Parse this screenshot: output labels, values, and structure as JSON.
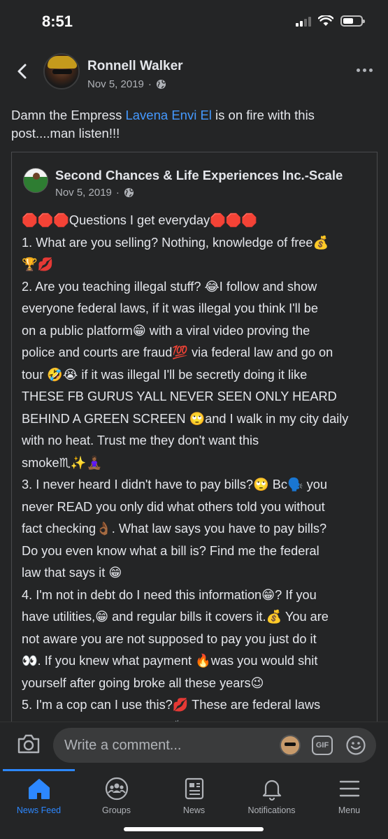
{
  "status_bar": {
    "time": "8:51"
  },
  "header": {
    "author": "Ronnell Walker",
    "date": "Nov 5, 2019",
    "separator": "·"
  },
  "post": {
    "text_before": "Damn the Empress ",
    "mention": "Lavena Envi El",
    "text_after": " is on fire with this post....man listen!!!"
  },
  "shared_post": {
    "author": "Second Chances & Life Experiences Inc.-Scale",
    "date": "Nov 5, 2019",
    "separator": "·",
    "lines": [
      "🛑🛑🛑Questions I get everyday🛑🛑🛑",
      "1. What are you selling? Nothing, knowledge of free💰",
      "🏆💋",
      "2. Are you teaching illegal stuff? 😂I follow and show",
      "everyone federal laws, if it was illegal you think I'll be",
      "on a public platform😁 with a viral video proving the",
      "police and courts are fraud💯 via federal law and go on",
      "tour 🤣😭 if it was illegal I'll be secretly doing it like",
      "THESE FB GURUS YALL NEVER SEEN ONLY HEARD",
      "BEHIND A GREEN SCREEN 🙄and I walk in my city daily",
      "with no heat. Trust me they don't want this",
      "smoke♏✨🧘🏾‍♀️",
      "3. I never heard I didn't have to pay bills?🙄 Bc🗣️ you",
      "never READ you only did what others told you without",
      "fact checking👌🏾. What law says you have to pay bills?",
      "Do you even know what a bill is? Find me the federal",
      "law that says it 😁",
      "4. I'm not in debt do I need this information😁? If you",
      "have utilities,😁 and regular bills it covers it.💰 You are",
      "not aware you are not supposed to pay you just do it",
      "👀. If you knew what payment 🔥was you would shit",
      "yourself after going broke all these years😉",
      "5. I'm a cop can I use this?💋 These are federal laws",
      "that govern the consumer👏🏾. If you don't identify"
    ]
  },
  "comment_bar": {
    "placeholder": "Write a comment...",
    "gif_label": "GIF"
  },
  "tabs": [
    {
      "label": "News Feed",
      "icon": "home-icon",
      "active": true
    },
    {
      "label": "Groups",
      "icon": "groups-icon",
      "active": false
    },
    {
      "label": "News",
      "icon": "news-icon",
      "active": false
    },
    {
      "label": "Notifications",
      "icon": "bell-icon",
      "active": false
    },
    {
      "label": "Menu",
      "icon": "menu-icon",
      "active": false
    }
  ],
  "colors": {
    "background": "#242526",
    "accent": "#2d88ff",
    "mention": "#4599ff",
    "text_primary": "#e4e6eb",
    "text_secondary": "#b0b3b8"
  }
}
